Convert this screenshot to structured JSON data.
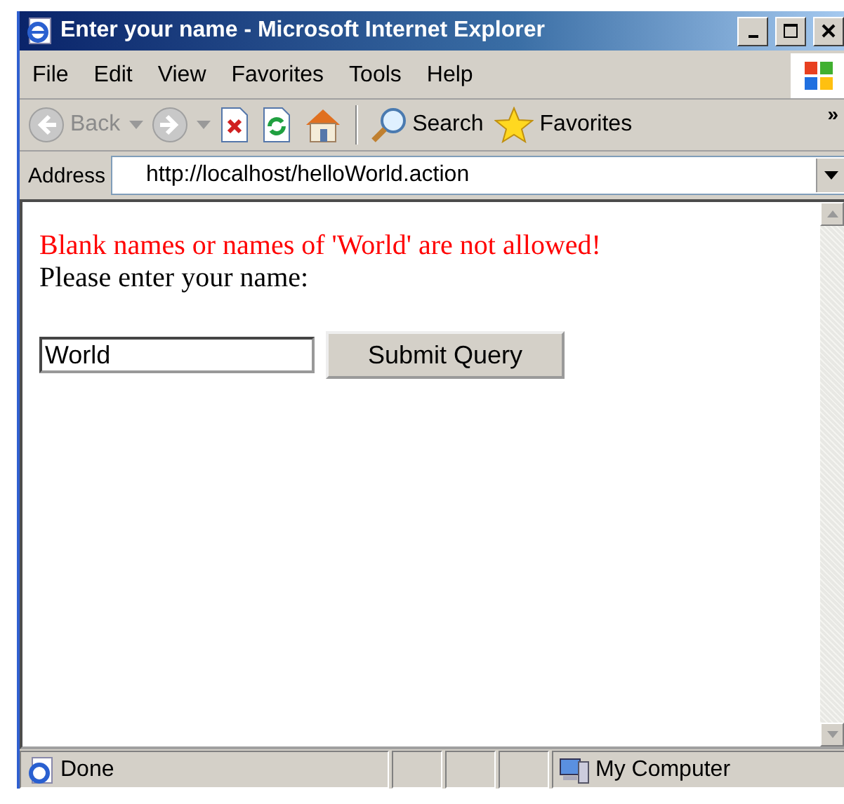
{
  "window": {
    "title": "Enter your name - Microsoft Internet Explorer"
  },
  "menu": [
    "File",
    "Edit",
    "View",
    "Favorites",
    "Tools",
    "Help"
  ],
  "toolbar": {
    "buttons": [
      {
        "kind": "back",
        "label": "Back",
        "disabled": true
      },
      {
        "kind": "forward",
        "disabled": true
      },
      {
        "kind": "stop",
        "disabled": false
      },
      {
        "kind": "refresh",
        "disabled": false
      },
      {
        "kind": "home",
        "disabled": false
      },
      {
        "kind": "search",
        "label": "Search",
        "disabled": false
      },
      {
        "kind": "favorites",
        "label": "Favorites",
        "disabled": false
      }
    ],
    "overflow": "»"
  },
  "address": {
    "label": "Address",
    "value": "http://localhost/helloWorld.action"
  },
  "page": {
    "error": "Blank names or names of 'World' are not allowed!",
    "prompt": "Please enter your name:",
    "name_field": {
      "value": "World"
    },
    "submit": "Submit Query"
  },
  "status_bar": {
    "text": "Done",
    "zone": "My Computer"
  }
}
